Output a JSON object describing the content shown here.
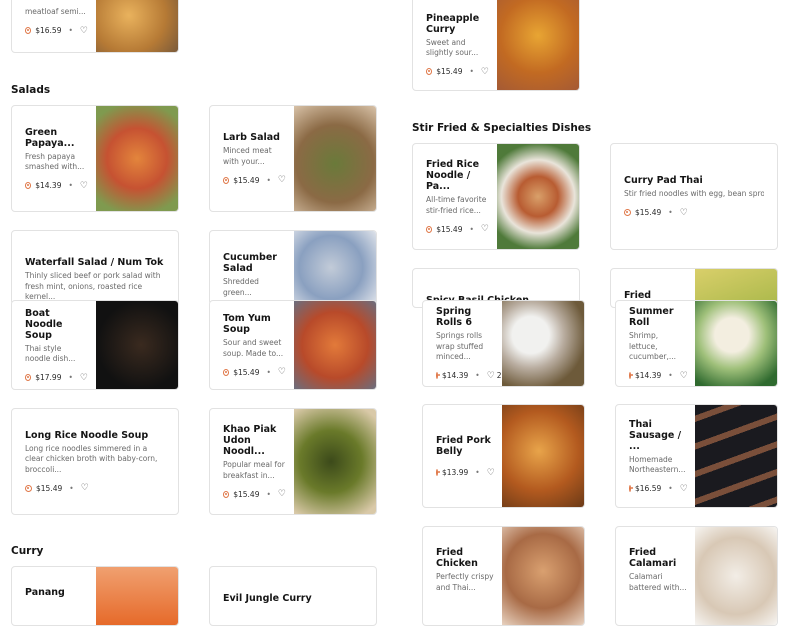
{
  "sections": {
    "salads": "Salads",
    "stir_fried": "Stir Fried & Specialties Dishes",
    "curry": "Curry"
  },
  "cards": [
    {
      "title": "",
      "desc": "meatloaf semi...",
      "price": "$16.59"
    },
    {
      "title": "Pineapple Curry",
      "desc": "Sweet and slightly sour...",
      "price": "$15.49"
    },
    {
      "title": "Green Papaya...",
      "desc": "Fresh papaya smashed with...",
      "price": "$14.39"
    },
    {
      "title": "Larb Salad",
      "desc": "Minced meat with your...",
      "price": "$15.49"
    },
    {
      "title": "Fried Rice Noodle / Pa...",
      "desc": "All-time favorite stir-fried rice...",
      "price": "$15.49"
    },
    {
      "title": "Curry Pad Thai",
      "desc": "Stir fried noodles with egg, bean sprouts and chives and mixed with...",
      "price": "$15.49"
    },
    {
      "title": "Waterfall Salad / Num Tok",
      "desc": "Thinly sliced beef or pork salad with fresh mint, onions, roasted rice kernel...",
      "price": ""
    },
    {
      "title": "Cucumber Salad",
      "desc": "Shredded green...",
      "price": ""
    },
    {
      "title": "Spicy Basil Chicken",
      "desc": "",
      "price": ""
    },
    {
      "title": "Fried Stewed",
      "desc": "",
      "price": ""
    },
    {
      "title": "Boat Noodle Soup",
      "desc": "Thai style noodle dish...",
      "price": "$17.99"
    },
    {
      "title": "Tom Yum Soup",
      "desc": "Sour and sweet soup. Made to...",
      "price": "$15.49"
    },
    {
      "title": "Spring Rolls 6",
      "desc": "Springs rolls wrap stuffed minced...",
      "price": "$14.39",
      "likes": "2"
    },
    {
      "title": "Summer Roll",
      "desc": "Shrimp, lettuce, cucumber,...",
      "price": "$14.39"
    },
    {
      "title": "Long Rice Noodle Soup",
      "desc": "Long rice noodles simmered in a clear chicken broth with baby-corn, broccoli...",
      "price": "$15.49"
    },
    {
      "title": "Khao Piak Udon Noodl...",
      "desc": "Popular meal for breakfast in...",
      "price": "$15.49"
    },
    {
      "title": "Fried Pork Belly",
      "desc": "",
      "price": "$13.99"
    },
    {
      "title": "Thai Sausage / ...",
      "desc": "Homemade Northeastern...",
      "price": "$16.59"
    },
    {
      "title": "Panang",
      "desc": "",
      "price": ""
    },
    {
      "title": "Evil Jungle Curry",
      "desc": "",
      "price": ""
    },
    {
      "title": "Fried Chicken",
      "desc": "Perfectly crispy and Thai...",
      "price": ""
    },
    {
      "title": "Fried Calamari",
      "desc": "Calamari battered with...",
      "price": ""
    }
  ],
  "colors": {
    "accent": "#e0794a",
    "border": "#e2e2e2"
  },
  "icons": {
    "price": "coin-icon",
    "favorite": "heart-icon"
  }
}
